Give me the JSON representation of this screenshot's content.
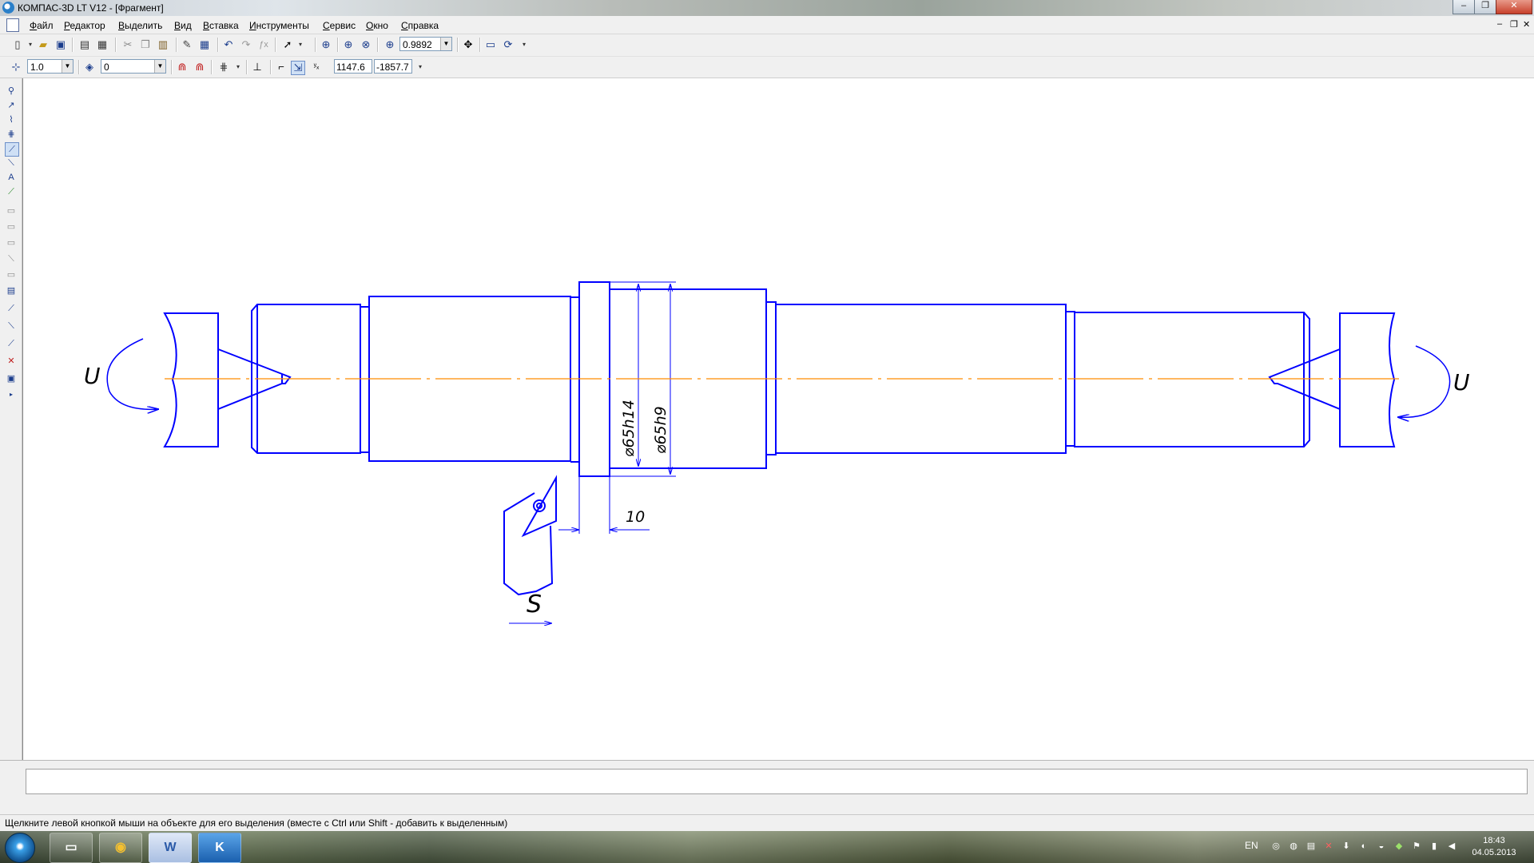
{
  "window": {
    "title": "КОМПАС-3D LT V12 - [Фрагмент]",
    "minimize": "–",
    "restore": "❐",
    "close": "✕"
  },
  "menu": {
    "items": [
      "Файл",
      "Редактор",
      "Выделить",
      "Вид",
      "Вставка",
      "Инструменты",
      "Сервис",
      "Окно",
      "Справка"
    ],
    "mdi_minimize": "–",
    "mdi_restore": "❐",
    "mdi_close": "✕"
  },
  "toolbar1": {
    "zoom_value": "0.9892"
  },
  "toolbar2": {
    "step_value": "1.0",
    "layer_value": "0",
    "coord_x": "1147.6",
    "coord_y": "-1857.7"
  },
  "drawing": {
    "label_u_left": "U",
    "label_u_right": "U",
    "dim_diameter_1": "⌀65h14",
    "dim_diameter_2": "⌀65h9",
    "dim_length": "10",
    "label_s": "S",
    "line_color": "#0000ff",
    "axis_color": "#ff8c00"
  },
  "status": {
    "hint": "Щелкните левой кнопкой мыши на объекте для его выделения (вместе с Ctrl или Shift - добавить к выделенным)"
  },
  "taskbar": {
    "apps": [
      {
        "name": "explorer",
        "glyph": "▭"
      },
      {
        "name": "chrome",
        "glyph": "◉"
      },
      {
        "name": "word",
        "glyph": "W"
      },
      {
        "name": "kompas",
        "glyph": "K"
      }
    ],
    "language": "EN",
    "time": "18:43",
    "date": "04.05.2013"
  }
}
